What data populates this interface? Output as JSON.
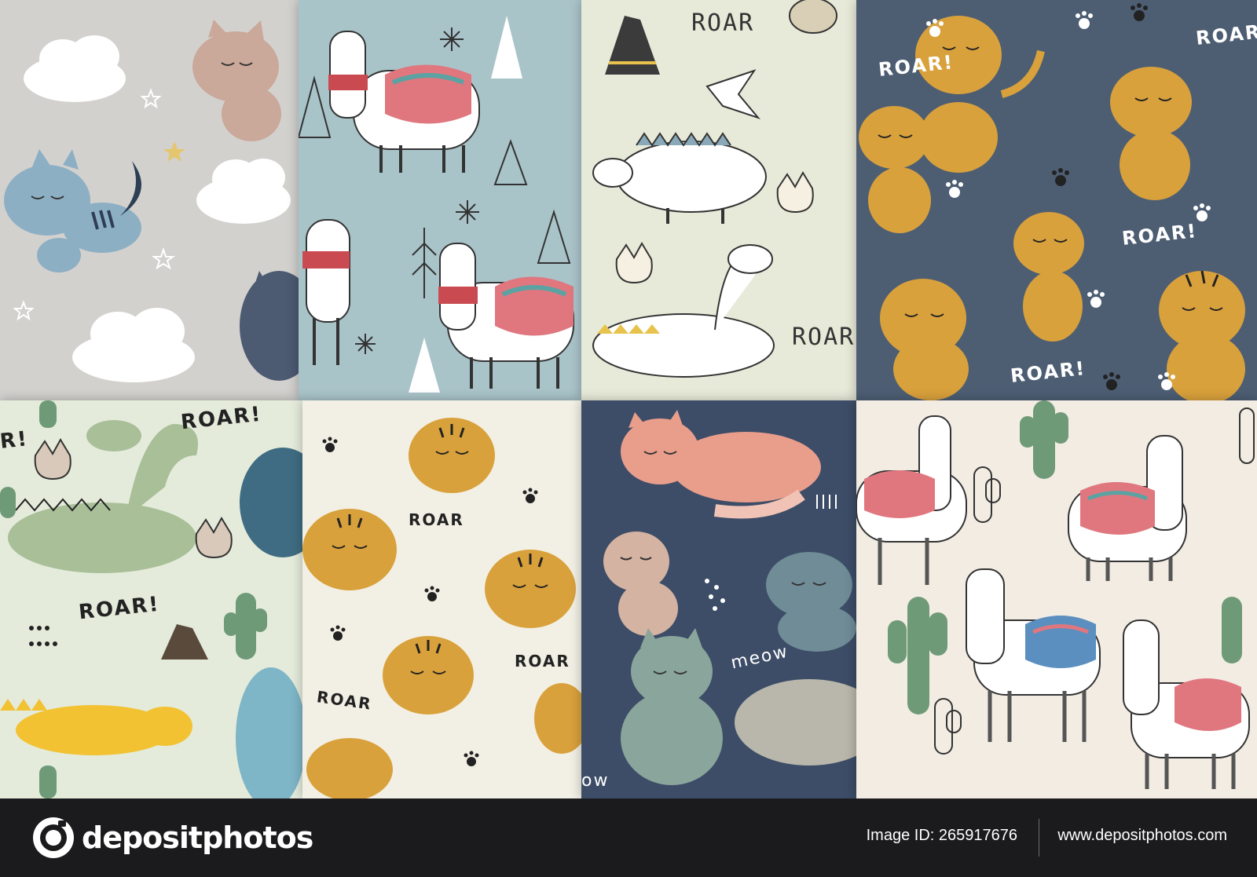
{
  "patterns": [
    {
      "theme": "cats-clouds",
      "background": "#d3d1ce",
      "labels": []
    },
    {
      "theme": "llamas-winter",
      "background": "#a9c4c9",
      "labels": []
    },
    {
      "theme": "dinosaurs",
      "background": "#e8ead9",
      "labels": [
        "ROAR",
        "ROAR"
      ]
    },
    {
      "theme": "tigers",
      "background": "#4d5e73",
      "labels": [
        "ROAR!",
        "ROAR!",
        "ROAR!",
        "ROAR!"
      ]
    },
    {
      "theme": "dinosaurs-cactus",
      "background": "#e4ebdb",
      "labels": [
        "ROAR!",
        "ROAR!",
        "R!"
      ]
    },
    {
      "theme": "tiger-faces",
      "background": "#f2f0e4",
      "labels": [
        "ROAR",
        "ROAR",
        "ROAR"
      ]
    },
    {
      "theme": "cats-night",
      "background": "#3d4d67",
      "labels": [
        "meow",
        "ow"
      ]
    },
    {
      "theme": "llamas-cactus",
      "background": "#f2ece3",
      "labels": []
    }
  ],
  "footer": {
    "brand": "depositphotos",
    "image_id": "Image ID: 265917676",
    "website": "www.depositphotos.com"
  },
  "colors": {
    "tiger": "#d9a13c",
    "tiger_stripe": "#2b2b2b",
    "llama_blanket": "#e0777f",
    "llama_accent": "#5aa3a2",
    "cactus": "#6f9a78",
    "dino": "#a8bf98",
    "footer_bg": "#1b1b1e"
  }
}
